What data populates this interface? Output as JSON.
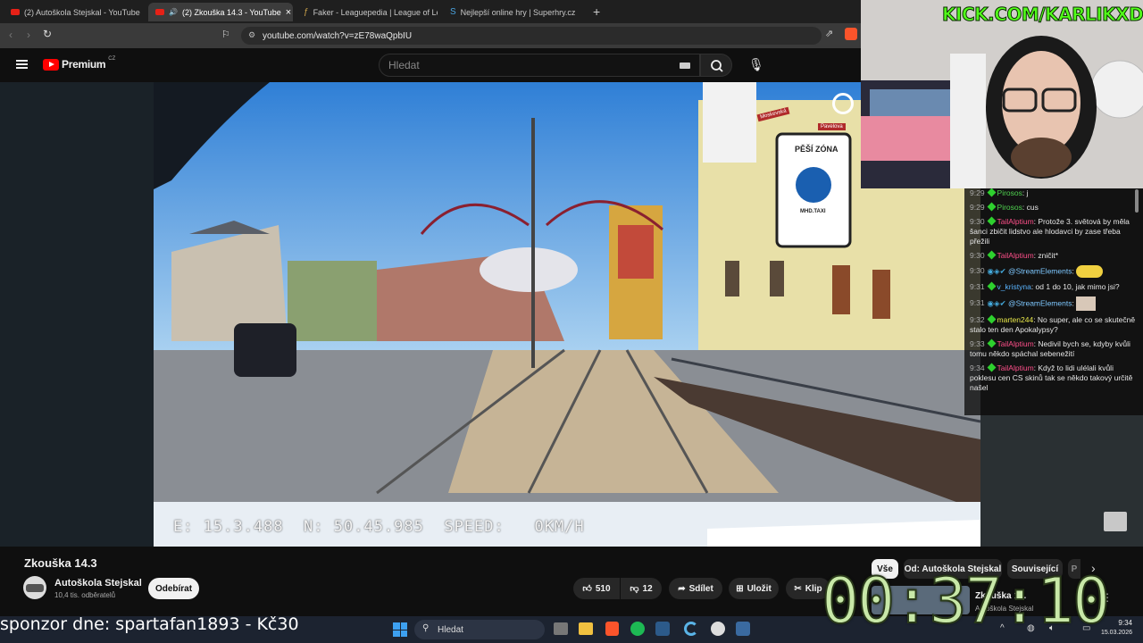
{
  "browser": {
    "tabs": [
      {
        "label": "(2) Autoškola Stejskal - YouTube",
        "color": "#e62117"
      },
      {
        "label": "(2) Zkouška 14.3 - YouTube",
        "color": "#e62117"
      },
      {
        "label": "Faker - Leaguepedia | League of Legends",
        "color": "#c8a04a"
      },
      {
        "label": "Nejlepší online hry | Superhry.cz",
        "color": "#4aa3df"
      }
    ],
    "url": "youtube.com/watch?v=zE78waQpbIU"
  },
  "youtube": {
    "brand": "Premium",
    "region": "CZ",
    "search_placeholder": "Hledat",
    "video": {
      "title": "Zkouška 14.3",
      "overlay_text": "E: 15.3.488  N: 50.45.985  SPEED:   0KM/H",
      "sign_zone": "PĚŠÍ ZÓNA",
      "sign_sub": "MHD.TAXI",
      "street_sign_1": "Moskevská",
      "street_sign_2": "Pavelova"
    },
    "channel": {
      "name": "Autoškola Stejskal",
      "subs": "10,4 tis. odběratelů"
    },
    "subscribe_label": "Odebírat",
    "actions": {
      "likes": "510",
      "dislikes": "12",
      "share": "Sdílet",
      "save": "Uložit",
      "clip": "Klip"
    },
    "filters": [
      "Vše",
      "Od: Autoškola Stejskal",
      "Související",
      "P"
    ],
    "suggested": {
      "title": "Zkouška 14.",
      "channel": "Autoškola Stejskal"
    }
  },
  "stream": {
    "kick": "KICK.COM/KARLIKXD",
    "sponsor": "sponzor dne: spartafan1893 - Kč30",
    "timer": "00:37:10"
  },
  "chat": [
    {
      "time": "9:29",
      "user": "Pirosos",
      "color": "#4fd04f",
      "text": "j"
    },
    {
      "time": "9:29",
      "user": "Pirosos",
      "color": "#4fd04f",
      "text": "cus"
    },
    {
      "time": "9:30",
      "user": "TailAlptium",
      "color": "#ff4f8a",
      "text": "Protože 3. světová by měla šanci zbičit lidstvo ale hlodavci by zase třeba přežili"
    },
    {
      "time": "9:30",
      "user": "TailAlptium",
      "color": "#ff4f8a",
      "text": "zničit*"
    },
    {
      "time": "9:30",
      "user": "@StreamElements",
      "color": "#7ec8ff",
      "text": ""
    },
    {
      "time": "9:31",
      "user": "v_kristyna",
      "color": "#5ab4ff",
      "text": "od 1 do 10, jak mimo jsi?"
    },
    {
      "time": "9:31",
      "user": "@StreamElements",
      "color": "#7ec8ff",
      "text": ""
    },
    {
      "time": "9:32",
      "user": "marten244",
      "color": "#e8e84a",
      "text": "No super, ale co se skutečně stalo ten den Apokalypsy?"
    },
    {
      "time": "9:33",
      "user": "TailAlptium",
      "color": "#ff4f8a",
      "text": "Nedivil bych se, kdyby kvůli tomu někdo spáchal sebenežití"
    },
    {
      "time": "9:34",
      "user": "TailAlptium",
      "color": "#ff4f8a",
      "text": "Když to lidi ulélali kvůli poklesu cen CS skinů tak se někdo takový určitě našel"
    }
  ],
  "taskbar": {
    "search": "Hledat",
    "time": "9:34",
    "date": "15.03.2026"
  }
}
